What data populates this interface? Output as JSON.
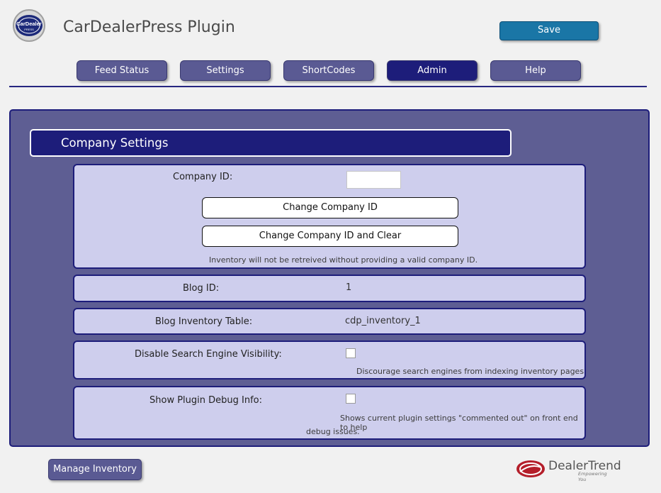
{
  "header": {
    "logo_text": "CarDealer",
    "logo_subtext": "PRESS",
    "title": "CarDealerPress Plugin",
    "save_label": "Save"
  },
  "tabs": [
    {
      "label": "Feed Status",
      "active": false
    },
    {
      "label": "Settings",
      "active": false
    },
    {
      "label": "ShortCodes",
      "active": false
    },
    {
      "label": "Admin",
      "active": true
    },
    {
      "label": "Help",
      "active": false
    }
  ],
  "section": {
    "title": "Company Settings"
  },
  "company": {
    "label": "Company ID:",
    "value": "",
    "change_button": "Change Company ID",
    "change_clear_button": "Change Company ID and Clear",
    "note": "Inventory will not be retreived without providing a valid company ID."
  },
  "blog": {
    "label": "Blog ID:",
    "value": "1"
  },
  "inventory_table": {
    "label": "Blog Inventory Table:",
    "value": "cdp_inventory_1"
  },
  "search_visibility": {
    "label": "Disable Search Engine Visibility:",
    "checked": false,
    "note": "Discourage search engines from indexing inventory pages"
  },
  "debug": {
    "label": "Show Plugin Debug Info:",
    "checked": false,
    "note_line1": "Shows current plugin settings \"commented out\" on front end to help",
    "note_line2": "debug issues."
  },
  "footer": {
    "manage_label": "Manage Inventory",
    "brand": "DealerTrend",
    "tagline": "Empowering You"
  },
  "colors": {
    "accent": "#1d1d7a",
    "tab": "#5a5a93",
    "panel": "#5e5e93",
    "card": "#ceceed",
    "save": "#1a76a6"
  }
}
